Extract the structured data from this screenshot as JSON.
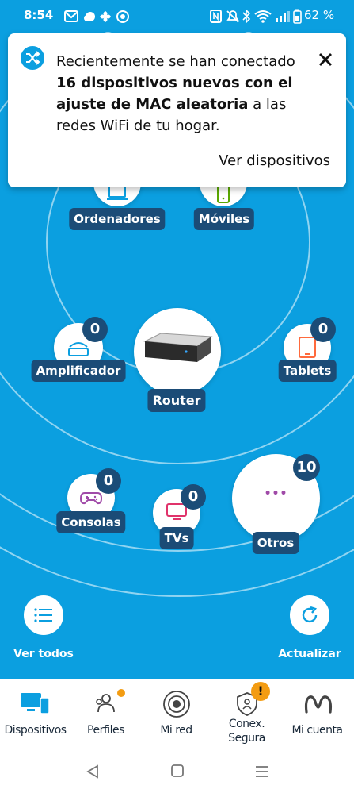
{
  "status_bar": {
    "time": "8:54",
    "battery": "62 %",
    "icons": [
      "gmail-icon",
      "weather-icon",
      "fan-icon",
      "chrome-icon",
      "nfc-icon",
      "mute-icon",
      "bluetooth-icon",
      "wifi-icon",
      "signal-icon",
      "battery-icon"
    ]
  },
  "notification": {
    "text_before": "Recientemente se han conectado ",
    "text_bold": "16 dispositivos nuevos con el ajuste de MAC aleatoria",
    "text_after": " a las redes WiFi de tu hogar.",
    "action": "Ver dispositivos",
    "icon": "shuffle-icon"
  },
  "devices": {
    "ordenadores": {
      "label": "Ordenadores"
    },
    "moviles": {
      "label": "Móviles"
    },
    "amplificador": {
      "label": "Amplificador",
      "count": "0"
    },
    "router": {
      "label": "Router"
    },
    "tablets": {
      "label": "Tablets",
      "count": "0"
    },
    "consolas": {
      "label": "Consolas",
      "count": "0"
    },
    "tvs": {
      "label": "TVs",
      "count": "0"
    },
    "otros": {
      "label": "Otros",
      "count": "10",
      "glyph": "•••"
    }
  },
  "actions": {
    "ver_todos": "Ver todos",
    "actualizar": "Actualizar"
  },
  "bottom_nav": [
    {
      "label": "Dispositivos",
      "icon": "devices-icon"
    },
    {
      "label": "Perfiles",
      "icon": "profiles-icon"
    },
    {
      "label": "Mi red",
      "icon": "network-icon"
    },
    {
      "label": "Conex.",
      "label2": "Segura",
      "icon": "shield-icon",
      "badge": "!"
    },
    {
      "label": "Mi cuenta",
      "icon": "movistar-logo-icon"
    }
  ],
  "colors": {
    "background": "#0b9fe0",
    "label_bg": "#1b4c77",
    "active_nav": "#0b9fe0",
    "badge_orange": "#f39c12"
  }
}
